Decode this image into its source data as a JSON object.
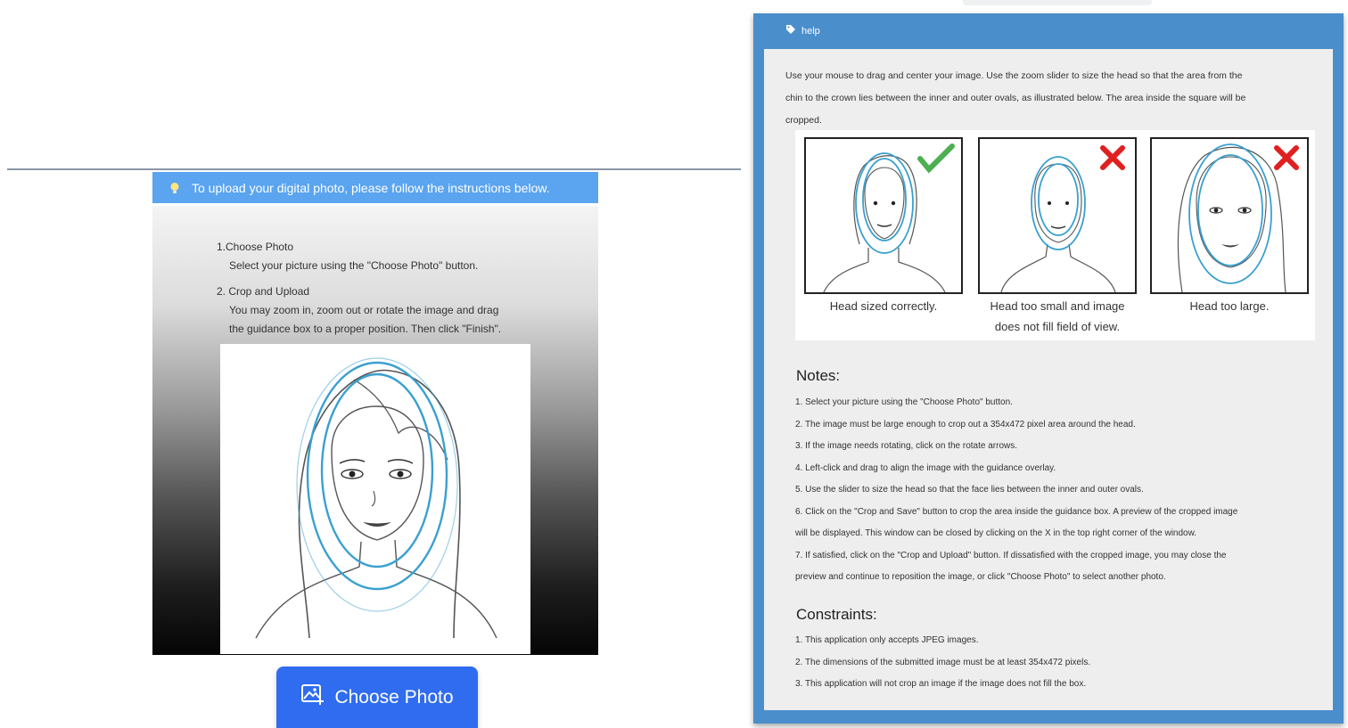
{
  "upload": {
    "header_text": "To upload your digital photo, please follow the instructions below.",
    "step1_title": "1.Choose Photo",
    "step1_desc": "Select your picture using the \"Choose Photo\" button.",
    "step2_title": "2. Crop and Upload",
    "step2_desc_line1": "You may zoom in, zoom out or rotate the image and drag",
    "step2_desc_line2": "the guidance box to a proper position. Then click \"Finish\".",
    "choose_button_label": "Choose Photo"
  },
  "help": {
    "title": "help",
    "intro_line1": "Use your mouse to drag and center your image. Use the zoom slider to size the head so that the area from the",
    "intro_line2": "chin to the crown lies between the inner and outer ovals, as illustrated below. The area inside the square will be",
    "intro_line3": "cropped.",
    "examples": [
      {
        "caption_line1": "Head sized correctly.",
        "caption_line2": "",
        "status": "correct"
      },
      {
        "caption_line1": "Head too small and image",
        "caption_line2": "does not fill field of view.",
        "status": "incorrect"
      },
      {
        "caption_line1": "Head too large.",
        "caption_line2": "",
        "status": "incorrect"
      }
    ],
    "notes_title": "Notes:",
    "notes": [
      "1. Select your picture using the \"Choose Photo\" button.",
      "2. The image must be large enough to crop out a 354x472 pixel area around the head.",
      "3. If the image needs rotating, click on the rotate arrows.",
      "4. Left-click and drag to align the image with the guidance overlay.",
      "5. Use the slider to size the head so that the face lies between the inner and outer ovals.",
      "6. Click on the \"Crop and Save\" button to crop the area inside the guidance box. A preview of the cropped image",
      "will be displayed. This window can be closed by clicking on the X in the top right corner of the window.",
      "7. If satisfied, click on the \"Crop and Upload\" button. If dissatisfied with the cropped image, you may close the",
      "preview and continue to reposition the image, or click \"Choose Photo\" to select another photo."
    ],
    "constraints_title": "Constraints:",
    "constraints": [
      "1. This application only accepts JPEG images.",
      "2. The dimensions of the submitted image must be at least 354x472 pixels.",
      "3. This application will not crop an image if the image does not fill the box."
    ]
  },
  "colors": {
    "header_blue": "#5aa4f0",
    "button_blue": "#2f6cf0",
    "help_frame_blue": "#4a8ecb",
    "oval_blue": "#3aa0d0",
    "check_green": "#4caf50",
    "cross_red": "#e02020"
  },
  "icons": {
    "header": "lightbulb-icon",
    "button": "image-upload-icon",
    "help": "tag-icon",
    "correct": "checkmark-icon",
    "incorrect": "cross-icon"
  }
}
